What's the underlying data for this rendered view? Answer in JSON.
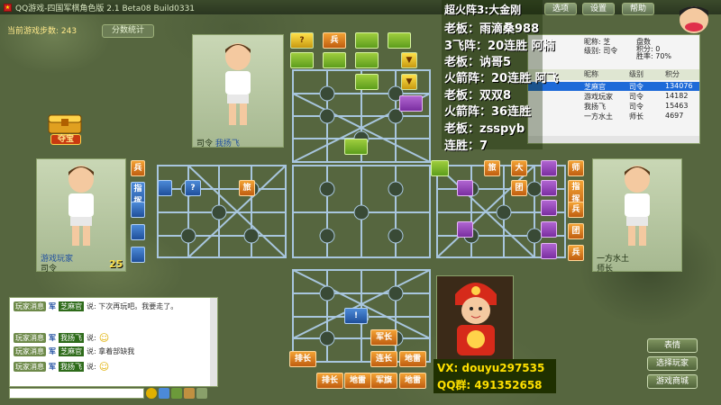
{
  "titlebar": {
    "title": "QQ游戏-四国军棋角色版 2.1 Beta08 Build0331",
    "buttons": [
      "选项",
      "设置",
      "帮助"
    ]
  },
  "top_left": {
    "steps": "当前游戏步数: 243",
    "stats_button": "分数统计",
    "treasure": "夺宝"
  },
  "players": {
    "top": {
      "rank": "司令",
      "name": "我扬飞"
    },
    "left": {
      "rank": "司令",
      "name": "游戏玩家",
      "count": "25"
    },
    "right": {
      "rank": "师长",
      "name": "一方水土"
    }
  },
  "board": {
    "top": [
      "?",
      "兵"
    ],
    "left": [
      "兵",
      "指挥",
      "?",
      "旅"
    ],
    "right": [
      "旅",
      "大",
      "团",
      "师",
      "指挥",
      "兵",
      "团",
      "兵"
    ],
    "bottom": [
      "!",
      "军长",
      "排长",
      "连长",
      "地雷",
      "排长",
      "地雷",
      "军旗",
      "地雷"
    ]
  },
  "chat": {
    "lines": [
      {
        "tag": "玩家消息",
        "lvl": "军",
        "name": "芝麻官",
        "text": "说: 下次再玩吧。我要走了。"
      },
      {
        "tag": "玩家消息",
        "lvl": "军",
        "name": "我扬飞",
        "text": "说:"
      },
      {
        "tag": "玩家消息",
        "lvl": "军",
        "name": "芝麻官",
        "text": "说: 拿着部缺我"
      },
      {
        "tag": "玩家消息",
        "lvl": "军",
        "name": "我扬飞",
        "text": "说:"
      }
    ]
  },
  "overlay": [
    "超火阵3:大金刚",
    "老板：雨滴桑988",
    "3飞阵：20连胜 阿楠",
    "老板：讷哥5",
    "火箭阵：20连胜 阿飞",
    "老板：双双8",
    "火箭阵：36连胜",
    "老板：zsspyb",
    "连胜：7"
  ],
  "info": {
    "labels": {
      "nick": "昵称:",
      "lvl": "级别:",
      "score": "积分:",
      "win": "胜率:"
    },
    "vals": {
      "nick": "芝",
      "lvl": "司令",
      "score": "0",
      "win": "70%"
    },
    "extra": "盘数",
    "head": [
      "昵称",
      "级别",
      "积分"
    ],
    "rows": [
      {
        "name": "芝麻官",
        "lvl": "司令",
        "score": "134076"
      },
      {
        "name": "游戏玩家",
        "lvl": "司令",
        "score": "14182"
      },
      {
        "name": "我扬飞",
        "lvl": "司令",
        "score": "15463"
      },
      {
        "name": "一方水土",
        "lvl": "师长",
        "score": "4697"
      }
    ]
  },
  "right_buttons": [
    "表情",
    "选择玩家",
    "游戏商城"
  ],
  "contact": {
    "vx": "VX: douyu297535",
    "qq": "QQ群: 491352658"
  },
  "colors": {
    "green": "#7ab82a",
    "purple": "#9a4cc0",
    "blue": "#2f67b8",
    "orange": "#e07a1c",
    "overlay_bg": "#2a3a00"
  }
}
